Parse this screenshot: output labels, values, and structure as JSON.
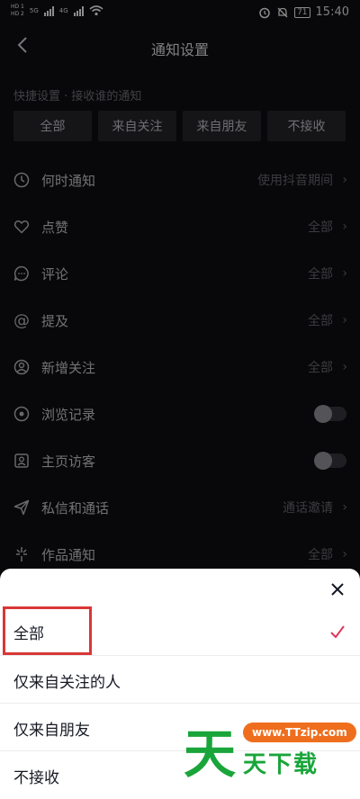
{
  "status_bar": {
    "hd1": "HD 1",
    "hd2": "HD 2",
    "net1": "5G",
    "net2": "4G",
    "battery": "71",
    "time": "15:40"
  },
  "header": {
    "title": "通知设置",
    "back_icon": "chevron-left-icon"
  },
  "quick_settings": {
    "label": "快捷设置 · 接收谁的通知",
    "chips": [
      "全部",
      "来自关注",
      "来自朋友",
      "不接收"
    ]
  },
  "settings": [
    {
      "icon": "clock-icon",
      "label": "何时通知",
      "value": "使用抖音期间",
      "control": "chevron"
    },
    {
      "icon": "heart-icon",
      "label": "点赞",
      "value": "全部",
      "control": "chevron"
    },
    {
      "icon": "comment-icon",
      "label": "评论",
      "value": "全部",
      "control": "chevron"
    },
    {
      "icon": "at-icon",
      "label": "提及",
      "value": "全部",
      "control": "chevron"
    },
    {
      "icon": "user-add-icon",
      "label": "新增关注",
      "value": "全部",
      "control": "chevron"
    },
    {
      "icon": "eye-icon",
      "label": "浏览记录",
      "value": "",
      "control": "toggle",
      "on": false
    },
    {
      "icon": "profile-icon",
      "label": "主页访客",
      "value": "",
      "control": "toggle",
      "on": false
    },
    {
      "icon": "send-icon",
      "label": "私信和通话",
      "value": "通话邀请",
      "control": "chevron"
    },
    {
      "icon": "sparkle-icon",
      "label": "作品通知",
      "value": "全部",
      "control": "chevron"
    }
  ],
  "sheet": {
    "close_icon": "close-icon",
    "options": [
      {
        "label": "全部",
        "selected": true
      },
      {
        "label": "仅来自关注的人",
        "selected": false
      },
      {
        "label": "仅来自朋友",
        "selected": false
      },
      {
        "label": "不接收",
        "selected": false
      }
    ],
    "check_color": "#e0345a",
    "highlight_color": "#d93636"
  },
  "watermark": {
    "big": "天",
    "url": "www.TTzip.com",
    "small": "天下载"
  }
}
